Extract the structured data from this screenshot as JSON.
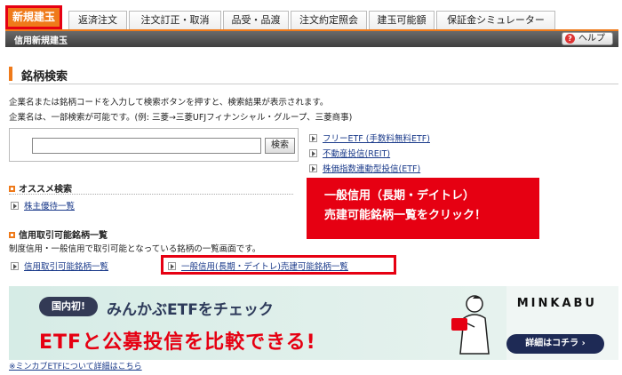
{
  "tabs": [
    "新規建玉",
    "返済注文",
    "注文訂正・取消",
    "品受・品渡",
    "注文約定照会",
    "建玉可能額",
    "保証金シミュレーター"
  ],
  "header": {
    "title": "信用新規建玉",
    "help_label": "ヘルプ",
    "help_icon": "?"
  },
  "section": {
    "title": "銘柄検索",
    "desc1": "企業名または銘柄コードを入力して検索ボタンを押すと、検索結果が表示されます。",
    "desc2": "企業名は、一部検索が可能です。(例: 三菱→三菱UFJフィナンシャル・グループ、三菱商事)"
  },
  "search": {
    "button": "検索",
    "placeholder": ""
  },
  "quick_links": [
    "フリーETF (手数料無料ETF)",
    "不動産投信(REIT)",
    "株価指数連動型投信(ETF)"
  ],
  "recommend": {
    "title": "オススメ検索",
    "link": "株主優待一覧"
  },
  "margin": {
    "title": "信用取引可能銘柄一覧",
    "desc": "制度信用・一般信用で取引可能となっている銘柄の一覧画面です。",
    "link1": "信用取引可能銘柄一覧",
    "link2": "一般信用(長期・デイトレ)売建可能銘柄一覧"
  },
  "callout": {
    "line1": "一般信用（長期・デイトレ）",
    "line2": "売建可能銘柄一覧をクリック！"
  },
  "banner": {
    "badge": "国内初!",
    "title": "みんかぶETFをチェック",
    "main": "ETFと公募投信を比較できる!",
    "brand": "MINKABU",
    "cta": "詳細はコチラ ›"
  },
  "footer_link": "※ミンカブETFについて詳細はこちら",
  "colors": {
    "accent": "#ef7a1a",
    "highlight": "#e60012",
    "link": "#1a3a8a"
  }
}
